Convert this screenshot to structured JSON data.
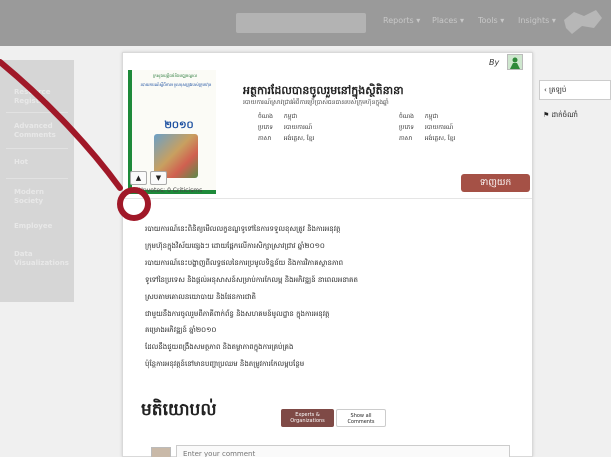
{
  "topbar": {
    "search_placeholder": "",
    "nav": [
      "Reports ▾",
      "Places ▾",
      "Tools ▾",
      "Insights ▾"
    ]
  },
  "sidebar": {
    "items": [
      "Resource Registry",
      "Advanced Comments",
      "Hot",
      "Modern Society",
      "Employee",
      "Data Visualizations"
    ]
  },
  "card": {
    "by_label": "By",
    "book": {
      "cover_header": "ក្រសួងយុត្តិធម៌និងមជ្ឈមណ្ឌល",
      "cover_title": "របាយការណ៍ស្តីពីការទទួលខុសត្រូវរបស់ក្រុមហ៊ុន",
      "cover_year": "២០១០",
      "cover_footer": "",
      "title": "អត្ថការដែលបានចូលរួមនៅក្នុងស្ថិតិនានា",
      "subtitle": "របាយការណ៍ស្រាវជ្រាវអំពីការប្រើប្រាស់ធនធានរបស់ក្រុមហ៊ុនក្នុងឆ្នាំ",
      "meta_left": [
        {
          "label": "ចំណង",
          "value": "កម្ពុជា"
        },
        {
          "label": "ប្រភេទ",
          "value": "របាយការណ៍"
        },
        {
          "label": "ភាសា",
          "value": "អង់គ្លេស, ខ្មែរ"
        }
      ],
      "meta_right": [
        {
          "label": "ចំណង",
          "value": "កម្ពុជា"
        },
        {
          "label": "ប្រភេទ",
          "value": "របាយការណ៍"
        },
        {
          "label": "ភាសា",
          "value": "អង់គ្លេស, ខ្មែរ"
        }
      ]
    },
    "vote_up": "▲",
    "vote_down": "▼",
    "upvotes_text": "84 Upvotes; 0 Criticisms",
    "download_label": "ទាញយក",
    "description": [
      "របាយការណ៍នេះពិនិត្យមើលលក្ខខណ្ឌទូទៅនៃការទទួលខុសត្រូវ និងការអនុវត្ត",
      "ក្រុមហ៊ុនក្នុងវិស័យផ្សេងៗ ដោយផ្អែកលើការសិក្សាស្រាវជ្រាវ ឆ្នាំ២០១០",
      "របាយការណ៍នេះបង្ហាញពីលទ្ធផលនៃការប្រមូលទិន្នន័យ និងការវិភាគស្ថានភាព",
      "ទូទៅនៃប្រទេស និងផ្តល់អនុសាសន៍សម្រាប់ការកែលម្អ និងអភិវឌ្ឍន៍ នាពេលអនាគត",
      "ស្របតាមគោលនយោបាយ និងផែនការជាតិ",
      "ជាមួយនឹងការចូលរួមពីភាគីពាក់ព័ន្ធ និងសហគមន៍មូលដ្ឋាន ក្នុងការអនុវត្ត",
      "គម្រោងអភិវឌ្ឍន៍ ឆ្នាំ២០១០",
      "ដែលនឹងជួយពង្រឹងសមត្ថភាព និងតម្លាភាពក្នុងការគ្រប់គ្រង",
      "ប៉ុន្តែការអនុវត្តន៍នៅមានបញ្ហាប្រឈម និងតម្រូវការកែលម្អបន្ថែម"
    ]
  },
  "comments": {
    "title": "មតិយោបល់",
    "tab_experts": "Experts & Organizations",
    "tab_all": "Show all Comments",
    "input_placeholder": "Enter your comment"
  },
  "right": {
    "back_label": "‹ ត្រឡប់",
    "share_label": "ដាក់ចំណាំ"
  },
  "colors": {
    "download_bg": "#a55146",
    "experts_tab_bg": "#7f4a46",
    "annotation": "#a01828",
    "cover_green": "#1e8a3a"
  }
}
